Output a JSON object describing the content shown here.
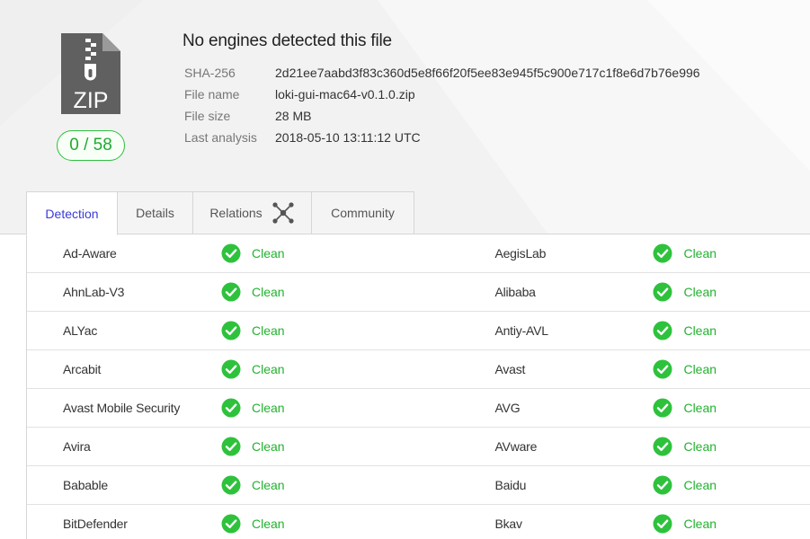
{
  "header": {
    "headline": "No engines detected this file",
    "file_type_icon": "zip-file-icon",
    "file_type_label": "ZIP",
    "score": "0 / 58",
    "score_color": "#22a832",
    "meta": [
      {
        "label": "SHA-256",
        "value": "2d21ee7aabd3f83c360d5e8f66f20f5ee83e945f5c900e717c1f8e6d7b76e996"
      },
      {
        "label": "File name",
        "value": "loki-gui-mac64-v0.1.0.zip"
      },
      {
        "label": "File size",
        "value": "28 MB"
      },
      {
        "label": "Last analysis",
        "value": "2018-05-10 13:11:12 UTC"
      }
    ]
  },
  "tabs": [
    {
      "label": "Detection",
      "active": true
    },
    {
      "label": "Details",
      "active": false
    },
    {
      "label": "Relations",
      "active": false,
      "icon": "graph-nodes-icon"
    },
    {
      "label": "Community",
      "active": false
    }
  ],
  "accent_color": "#3b3bd8",
  "clean_color": "#22b32f",
  "detections": [
    {
      "left": {
        "engine": "Ad-Aware",
        "status": "Clean"
      },
      "right": {
        "engine": "AegisLab",
        "status": "Clean"
      }
    },
    {
      "left": {
        "engine": "AhnLab-V3",
        "status": "Clean"
      },
      "right": {
        "engine": "Alibaba",
        "status": "Clean"
      }
    },
    {
      "left": {
        "engine": "ALYac",
        "status": "Clean"
      },
      "right": {
        "engine": "Antiy-AVL",
        "status": "Clean"
      }
    },
    {
      "left": {
        "engine": "Arcabit",
        "status": "Clean"
      },
      "right": {
        "engine": "Avast",
        "status": "Clean"
      }
    },
    {
      "left": {
        "engine": "Avast Mobile Security",
        "status": "Clean"
      },
      "right": {
        "engine": "AVG",
        "status": "Clean"
      }
    },
    {
      "left": {
        "engine": "Avira",
        "status": "Clean"
      },
      "right": {
        "engine": "AVware",
        "status": "Clean"
      }
    },
    {
      "left": {
        "engine": "Babable",
        "status": "Clean"
      },
      "right": {
        "engine": "Baidu",
        "status": "Clean"
      }
    },
    {
      "left": {
        "engine": "BitDefender",
        "status": "Clean"
      },
      "right": {
        "engine": "Bkav",
        "status": "Clean"
      }
    }
  ]
}
